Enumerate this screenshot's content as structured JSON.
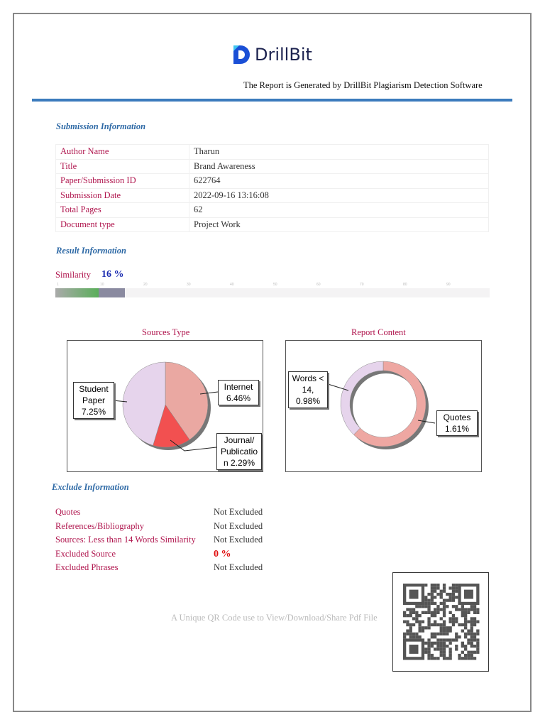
{
  "header": {
    "logo_text": "DrillBit",
    "generated_by": "The Report is Generated by DrillBit Plagiarism Detection Software"
  },
  "submission": {
    "heading": "Submission Information",
    "rows": [
      {
        "label": "Author Name",
        "value": "Tharun"
      },
      {
        "label": "Title",
        "value": "Brand Awareness"
      },
      {
        "label": "Paper/Submission ID",
        "value": "622764"
      },
      {
        "label": "Submission Date",
        "value": "2022-09-16 13:16:08"
      },
      {
        "label": "Total Pages",
        "value": "62"
      },
      {
        "label": "Document type",
        "value": "Project Work"
      }
    ]
  },
  "result": {
    "heading": "Result Information",
    "similarity_label": "Similarity",
    "similarity_value": "16 %",
    "similarity_percent": 16,
    "ticks": [
      "1",
      "10",
      "20",
      "30",
      "40",
      "50",
      "60",
      "70",
      "80",
      "90"
    ]
  },
  "chart_data": [
    {
      "type": "pie",
      "title": "Sources Type",
      "categories": [
        "Internet",
        "Journal/ Publication",
        "Student Paper"
      ],
      "values": [
        6.46,
        2.29,
        7.25
      ],
      "labels": [
        "Internet 6.46%",
        "Journal/ Publicatio n 2.29%",
        "Student Paper 7.25%"
      ],
      "colors": [
        "#eaa8a2",
        "#f25050",
        "#e6d4ec"
      ]
    },
    {
      "type": "pie",
      "title": "Report Content",
      "categories": [
        "Quotes",
        "Words < 14"
      ],
      "values": [
        1.61,
        0.98
      ],
      "labels": [
        "Quotes 1.61%",
        "Words < 14, 0.98%"
      ],
      "colors": [
        "#eea7a2",
        "#e6d4ec"
      ]
    }
  ],
  "exclude": {
    "heading": "Exclude Information",
    "rows": [
      {
        "label": "Quotes",
        "value": "Not Excluded"
      },
      {
        "label": "References/Bibliography",
        "value": "Not Excluded"
      },
      {
        "label": "Sources: Less than 14 Words Similarity",
        "value": "Not Excluded"
      },
      {
        "label": "Excluded Source",
        "value": "0 %"
      },
      {
        "label": "Excluded Phrases",
        "value": "Not Excluded"
      }
    ]
  },
  "qr": {
    "caption": "A Unique QR Code use to View/Download/Share Pdf File"
  }
}
